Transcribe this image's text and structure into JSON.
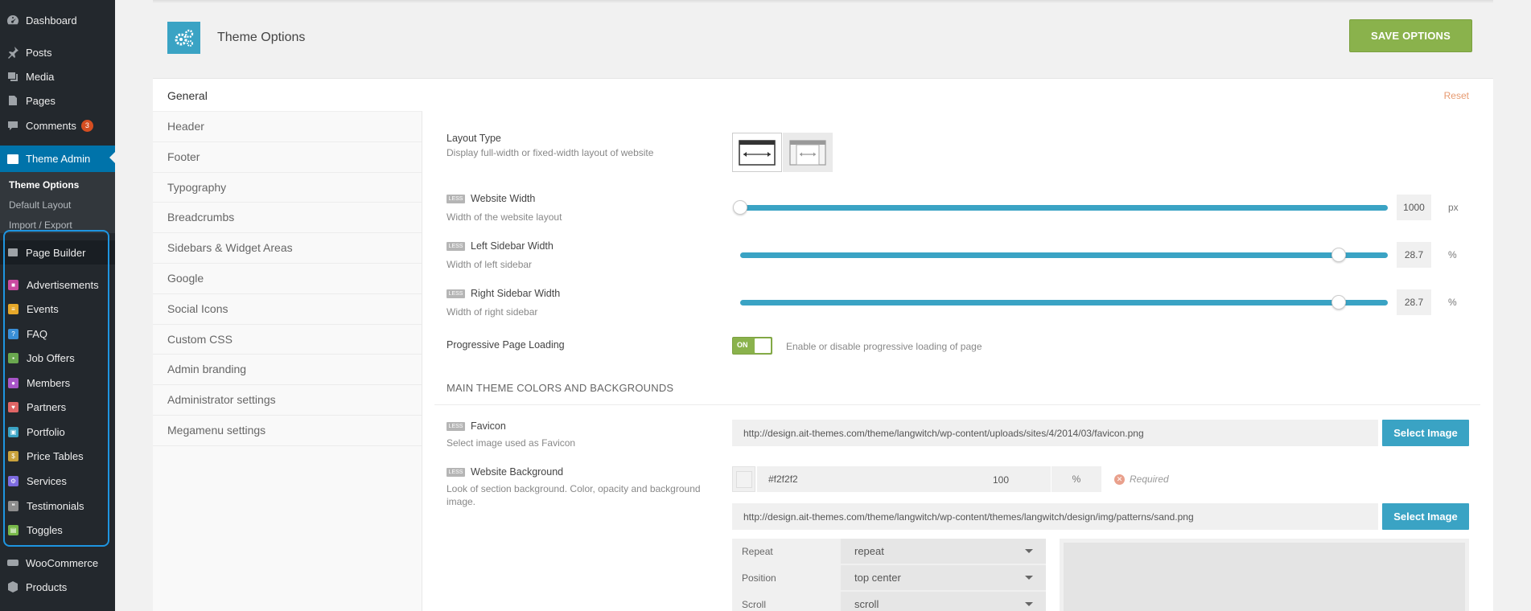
{
  "sidebar": {
    "dashboard": "Dashboard",
    "posts": "Posts",
    "media": "Media",
    "pages": "Pages",
    "comments": "Comments",
    "comments_badge": "3",
    "theme_admin": "Theme Admin",
    "submenu": [
      "Theme Options",
      "Default Layout",
      "Import / Export"
    ],
    "page_builder": "Page Builder",
    "post_types": [
      {
        "label": "Advertisements",
        "color": "#c94aa0"
      },
      {
        "label": "Events",
        "color": "#e6a82a"
      },
      {
        "label": "FAQ",
        "color": "#3a8fd6"
      },
      {
        "label": "Job Offers",
        "color": "#6aa84f"
      },
      {
        "label": "Members",
        "color": "#a855c8"
      },
      {
        "label": "Partners",
        "color": "#e06666"
      },
      {
        "label": "Portfolio",
        "color": "#3aa3c4"
      },
      {
        "label": "Price Tables",
        "color": "#c9a23c"
      },
      {
        "label": "Services",
        "color": "#7d6be0"
      },
      {
        "label": "Testimonials",
        "color": "#8e8e8e"
      },
      {
        "label": "Toggles",
        "color": "#78b84a"
      }
    ],
    "woocommerce": "WooCommerce",
    "products": "Products"
  },
  "header": {
    "title": "Theme Options",
    "save_button": "SAVE OPTIONS"
  },
  "panel": {
    "section_title": "General",
    "reset": "Reset",
    "nav": [
      "Header",
      "Footer",
      "Typography",
      "Breadcrumbs",
      "Sidebars & Widget Areas",
      "Google",
      "Social Icons",
      "Custom CSS",
      "Admin branding",
      "Administrator settings",
      "Megamenu settings"
    ]
  },
  "options": {
    "less_tag": "LESS",
    "layout_type": {
      "title": "Layout Type",
      "desc": "Display full-width or fixed-width layout of website",
      "selected": "full-width"
    },
    "website_width": {
      "title": "Website Width",
      "desc": "Width of the website layout",
      "value": "1000",
      "unit": "px",
      "fraction": 0.0
    },
    "left_sidebar": {
      "title": "Left Sidebar Width",
      "desc": "Width of left sidebar",
      "value": "28.7",
      "unit": "%",
      "fraction": 0.924
    },
    "right_sidebar": {
      "title": "Right Sidebar Width",
      "desc": "Width of right sidebar",
      "value": "28.7",
      "unit": "%",
      "fraction": 0.924
    },
    "progressive": {
      "title": "Progressive Page Loading",
      "toggle": "ON",
      "desc": "Enable or disable progressive loading of page"
    },
    "colors_heading": "MAIN THEME COLORS AND BACKGROUNDS",
    "favicon": {
      "title": "Favicon",
      "desc": "Select image used as Favicon",
      "url": "http://design.ait-themes.com/theme/langwitch/wp-content/uploads/sites/4/2014/03/favicon.png",
      "button": "Select Image"
    },
    "background": {
      "title": "Website Background",
      "desc": "Look of section background. Color, opacity and background image.",
      "color": "#f2f2f2",
      "opacity": "100",
      "opacity_unit": "%",
      "required": "Required",
      "url": "http://design.ait-themes.com/theme/langwitch/wp-content/themes/langwitch/design/img/patterns/sand.png",
      "button": "Select Image",
      "rows": [
        {
          "label": "Repeat",
          "value": "repeat"
        },
        {
          "label": "Position",
          "value": "top center"
        },
        {
          "label": "Scroll",
          "value": "scroll"
        }
      ]
    }
  },
  "colors": {
    "accent": "#3aa3c4",
    "save": "#8ab24c",
    "wp_active": "#0073aa",
    "sidebar_bg": "#23282d",
    "highlight": "#1e95e0"
  }
}
